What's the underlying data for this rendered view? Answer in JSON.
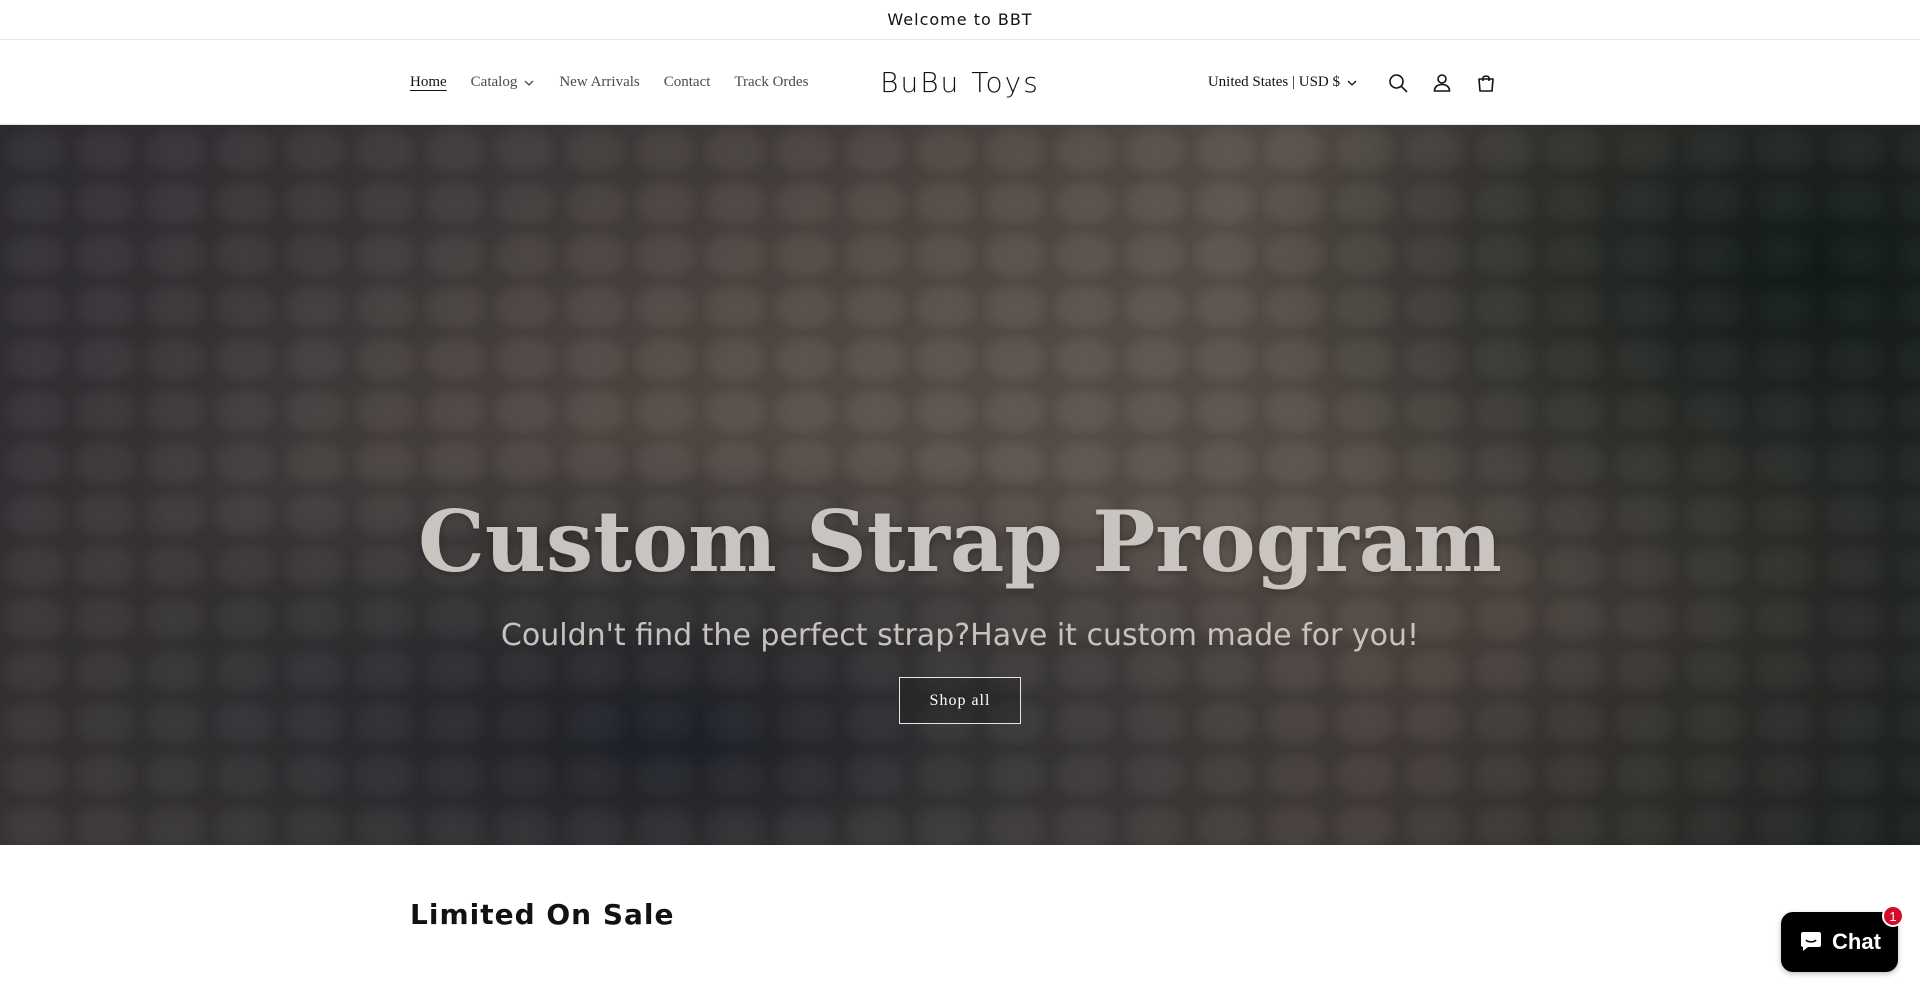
{
  "announcement": {
    "text": "Welcome to BBT"
  },
  "nav": {
    "items": [
      {
        "label": "Home",
        "active": true
      },
      {
        "label": "Catalog",
        "has_dropdown": true
      },
      {
        "label": "New Arrivals"
      },
      {
        "label": "Contact"
      },
      {
        "label": "Track Ordes"
      }
    ]
  },
  "brand": {
    "name": "BuBu Toys"
  },
  "header_tools": {
    "locale": "United States | USD $",
    "icons": [
      "search-icon",
      "account-icon",
      "cart-icon"
    ]
  },
  "hero": {
    "title": "Custom Strap Program",
    "subtitle": "Couldn't find the perfect strap?Have it custom made for you!",
    "button_label": "Shop all"
  },
  "section": {
    "title": "Limited On Sale"
  },
  "chat": {
    "label": "Chat",
    "badge_count": "1"
  },
  "colors": {
    "text": "#121212",
    "nav_text": "#4a4a4a",
    "chat_bg": "#000000",
    "badge": "#d40c2a"
  }
}
